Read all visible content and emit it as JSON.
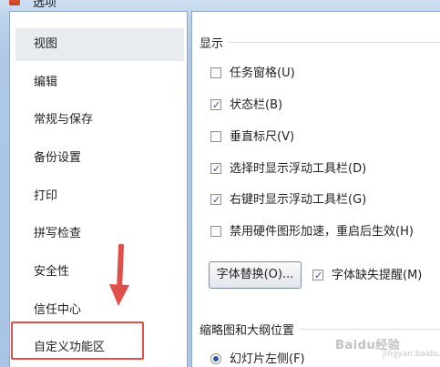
{
  "window": {
    "title": "选项"
  },
  "nav": {
    "items": [
      {
        "label": "视图",
        "selected": true
      },
      {
        "label": "编辑",
        "selected": false
      },
      {
        "label": "常规与保存",
        "selected": false
      },
      {
        "label": "备份设置",
        "selected": false
      },
      {
        "label": "打印",
        "selected": false
      },
      {
        "label": "拼写检查",
        "selected": false
      },
      {
        "label": "安全性",
        "selected": false
      },
      {
        "label": "信任中心",
        "selected": false
      },
      {
        "label": "自定义功能区",
        "selected": false
      }
    ],
    "highlight_color": "#e0504a"
  },
  "display": {
    "section_title": "显示",
    "options": [
      {
        "label": "任务窗格(U)",
        "checked": false
      },
      {
        "label": "状态栏(B)",
        "checked": true
      },
      {
        "label": "垂直标尺(V)",
        "checked": false
      },
      {
        "label": "选择时显示浮动工具栏(D)",
        "checked": true
      },
      {
        "label": "右键时显示浮动工具栏(G)",
        "checked": true
      },
      {
        "label": "禁用硬件图形加速，重启后生效(H)",
        "checked": false
      }
    ],
    "font_replace_button": "字体替换(O)...",
    "font_missing_reminder": {
      "label": "字体缺失提醒(M)",
      "checked": true
    }
  },
  "thumbnail": {
    "section_title": "缩略图和大纲位置",
    "options": [
      {
        "label": "幻灯片左侧(F)",
        "selected": true
      }
    ]
  },
  "watermark": {
    "text": "Baidu经验",
    "sub": "jingyan.baidu.com"
  }
}
